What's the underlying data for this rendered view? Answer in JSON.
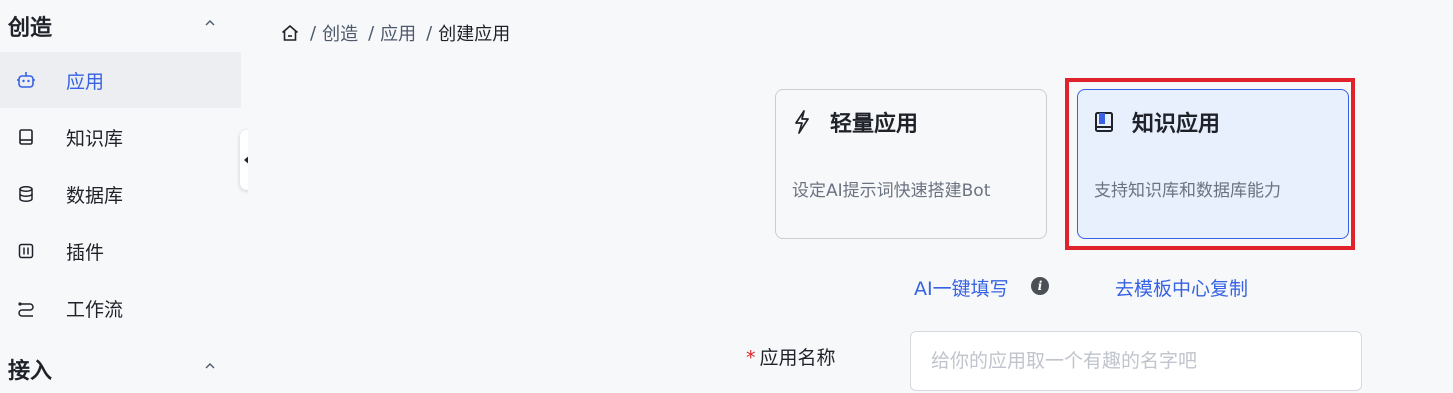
{
  "sidebar": {
    "section_create": {
      "title": "创造"
    },
    "items": [
      {
        "label": "应用",
        "icon": "robot-icon",
        "active": true
      },
      {
        "label": "知识库",
        "icon": "book-icon"
      },
      {
        "label": "数据库",
        "icon": "database-icon"
      },
      {
        "label": "插件",
        "icon": "plugin-icon"
      },
      {
        "label": "工作流",
        "icon": "workflow-icon"
      }
    ],
    "section_access": {
      "title": "接入"
    }
  },
  "breadcrumb": {
    "home_icon": "home-icon",
    "items": [
      "创造",
      "应用",
      "创建应用"
    ],
    "separator": "/"
  },
  "cards": [
    {
      "title": "轻量应用",
      "desc": "设定AI提示词快速搭建Bot",
      "icon": "lightning-icon",
      "selected": false
    },
    {
      "title": "知识应用",
      "desc": "支持知识库和数据库能力",
      "icon": "book-icon",
      "selected": true
    }
  ],
  "links": {
    "ai_fill": "AI一键填写",
    "template_copy": "去模板中心复制",
    "info_icon": "info-icon"
  },
  "form": {
    "name_label": "应用名称",
    "required_mark": "*",
    "name_placeholder": "给你的应用取一个有趣的名字吧",
    "name_value": ""
  },
  "colors": {
    "accent": "#3662e3",
    "highlight_border": "#e0222b",
    "selected_bg": "#e8effd"
  }
}
